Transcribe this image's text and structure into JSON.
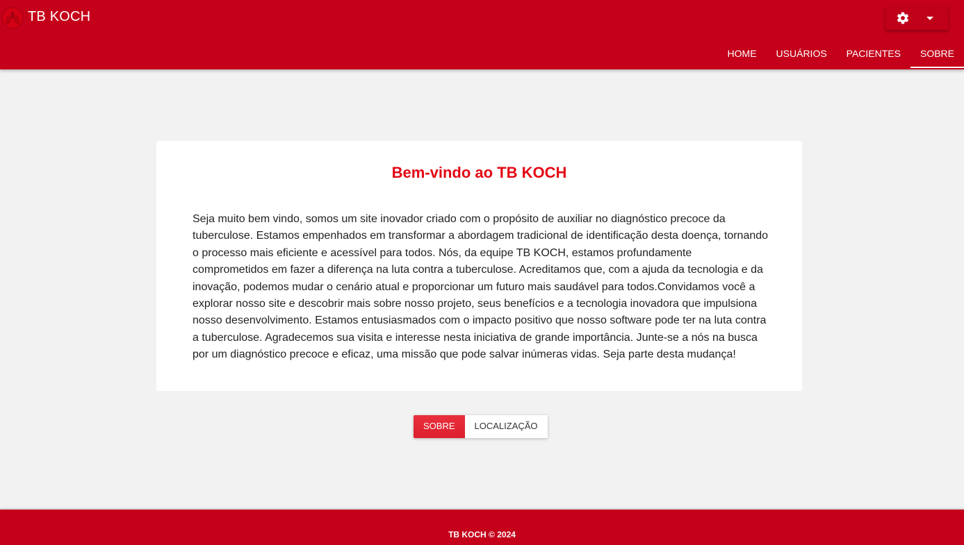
{
  "header": {
    "brand": "TB KOCH",
    "logo_icon": "lungs-logo-icon",
    "settings_icon": "gear-icon",
    "dropdown_icon": "caret-down-icon",
    "background_color": "#c4001a"
  },
  "nav": {
    "items": [
      {
        "label": "HOME"
      },
      {
        "label": "USUÁRIOS"
      },
      {
        "label": "PACIENTES"
      },
      {
        "label": "SOBRE"
      }
    ],
    "active": "SOBRE"
  },
  "main": {
    "title": "Bem-vindo ao TB KOCH",
    "title_color": "#e30613",
    "body": "Seja muito bem vindo, somos um site inovador criado com o propósito de auxiliar no diagnóstico precoce da tuberculose. Estamos empenhados em transformar a abordagem tradicional de identificação desta doença, tornando o processo mais eficiente e acessível para todos. Nós, da equipe TB KOCH, estamos profundamente comprometidos em fazer a diferença na luta contra a tuberculose. Acreditamos que, com a ajuda da tecnologia e da inovação, podemos mudar o cenário atual e proporcionar um futuro mais saudável para todos.Convidamos você a explorar nosso site e descobrir mais sobre nosso projeto, seus benefícios e a tecnologia inovadora que impulsiona nosso desenvolvimento. Estamos entusiasmados com o impacto positivo que nosso software pode ter na luta contra a tuberculose. Agradecemos sua visita e interesse nesta iniciativa de grande importância. Junte-se a nós na busca por um diagnóstico precoce e eficaz, uma missão que pode salvar inúmeras vidas. Seja parte desta mudança!"
  },
  "tabs": {
    "items": [
      {
        "label": "SOBRE"
      },
      {
        "label": "LOCALIZAÇÃO"
      }
    ],
    "active": "SOBRE"
  },
  "footer": {
    "text": "TB KOCH © 2024"
  }
}
